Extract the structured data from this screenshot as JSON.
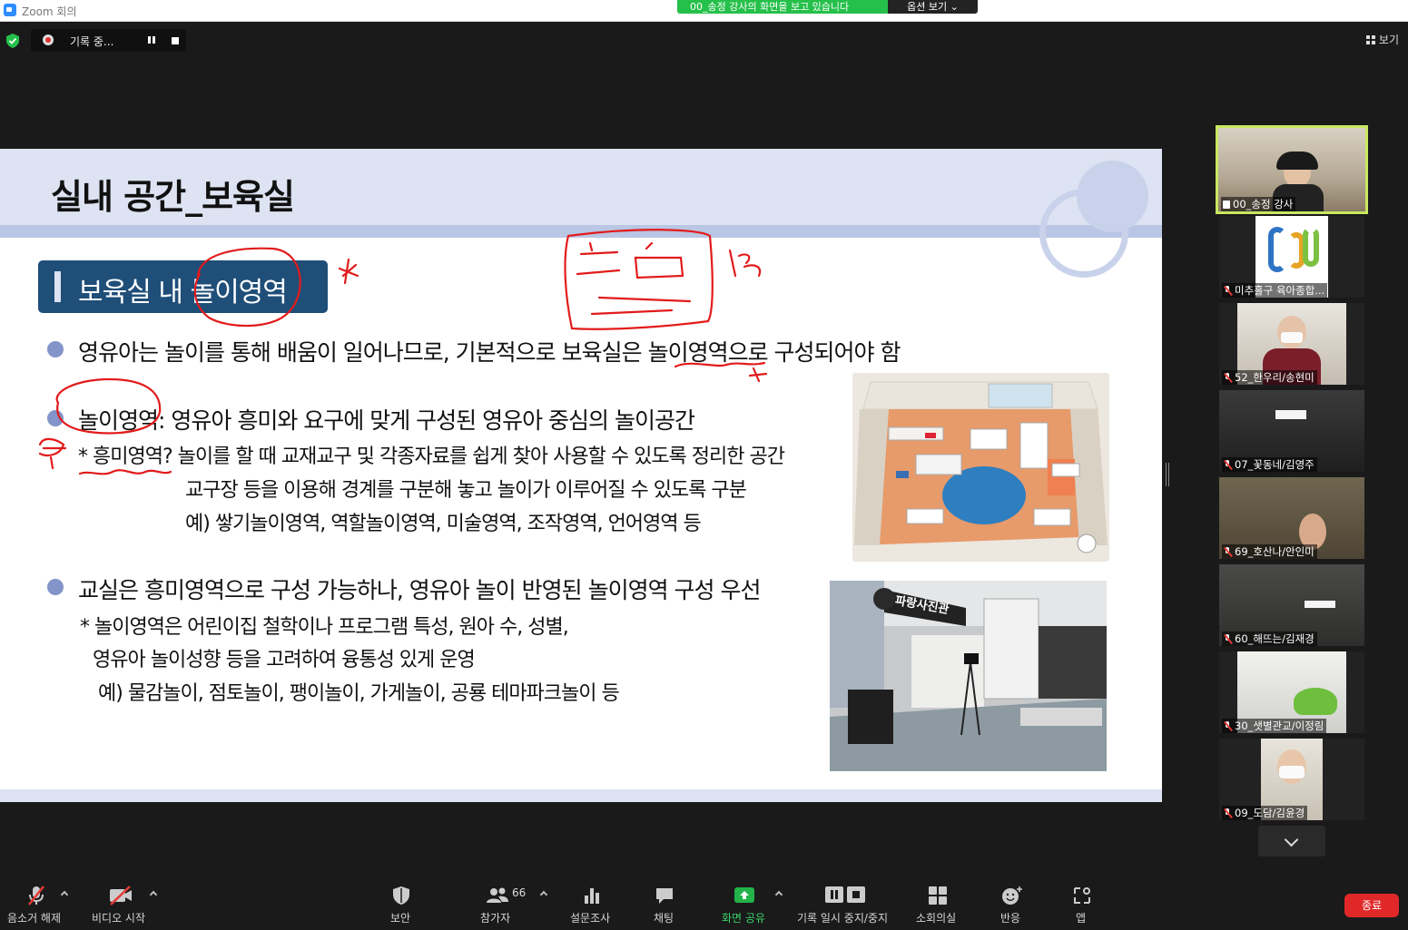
{
  "window": {
    "title": "Zoom 회의"
  },
  "share_banner": {
    "message": "00_송정 강사의 화면을 보고 있습니다",
    "options": "옵션 보기 ⌄"
  },
  "recording": {
    "label": "기록 중..."
  },
  "view": {
    "label": "보기"
  },
  "slide": {
    "title": "실내 공간_보육실",
    "section": "보육실 내 놀이영역",
    "bullet1": "영유아는 놀이를 통해 배움이 일어나므로, 기본적으로 보육실은 놀이영역으로 구성되어야 함",
    "bullet2": "놀이영역:  영유아 흥미와 요구에 맞게 구성된 영유아 중심의 놀이공간",
    "bullet2_sub1": "* 흥미영역? 놀이를 할 때 교재교구 및 각종자료를 쉽게 찾아 사용할 수 있도록 정리한 공간",
    "bullet2_sub2": "교구장 등을 이용해 경계를 구분해 놓고 놀이가 이루어질 수 있도록 구분",
    "bullet2_sub3": "예) 쌓기놀이영역, 역할놀이영역, 미술영역, 조작영역, 언어영역 등",
    "bullet3": "교실은 흥미영역으로 구성 가능하나, 영유아 놀이 반영된 놀이영역 구성 우선",
    "bullet3_sub1": "* 놀이영역은 어린이집 철학이나 프로그램 특성, 원아 수, 성별,",
    "bullet3_sub2": "영유아 놀이성향 등을 고려하여 융통성 있게 운영",
    "bullet3_sub3": "예) 물감놀이, 점토놀이, 팽이놀이, 가게놀이, 공룡 테마파크놀이 등",
    "photo2_sign": "파랑사진관"
  },
  "participants": [
    {
      "name": "00_송정 강사",
      "active": true
    },
    {
      "name": "미추홀구 육아종합..."
    },
    {
      "name": "52_한우리/송현미"
    },
    {
      "name": "07_꽃동네/김영주"
    },
    {
      "name": "69_호산나/안인미"
    },
    {
      "name": "60_해뜨는/김재경"
    },
    {
      "name": "30_샛별관교/이정림"
    },
    {
      "name": "09_도담/김윤경"
    }
  ],
  "toolbar": {
    "unmute": "음소거 해제",
    "start_video": "비디오 시작",
    "security": "보안",
    "participants": "참가자",
    "participants_count": "66",
    "polls": "설문조사",
    "chat": "채팅",
    "share_screen": "화면 공유",
    "pause_recording": "기록 일시 중지/중지",
    "breakout": "소회의실",
    "reactions": "반응",
    "apps": "앱",
    "end": "종료"
  },
  "colors": {
    "accent_green": "#25c04a",
    "end_red": "#e02828",
    "slide_navy": "#1f4e79",
    "active_speaker": "#c9e85f"
  }
}
